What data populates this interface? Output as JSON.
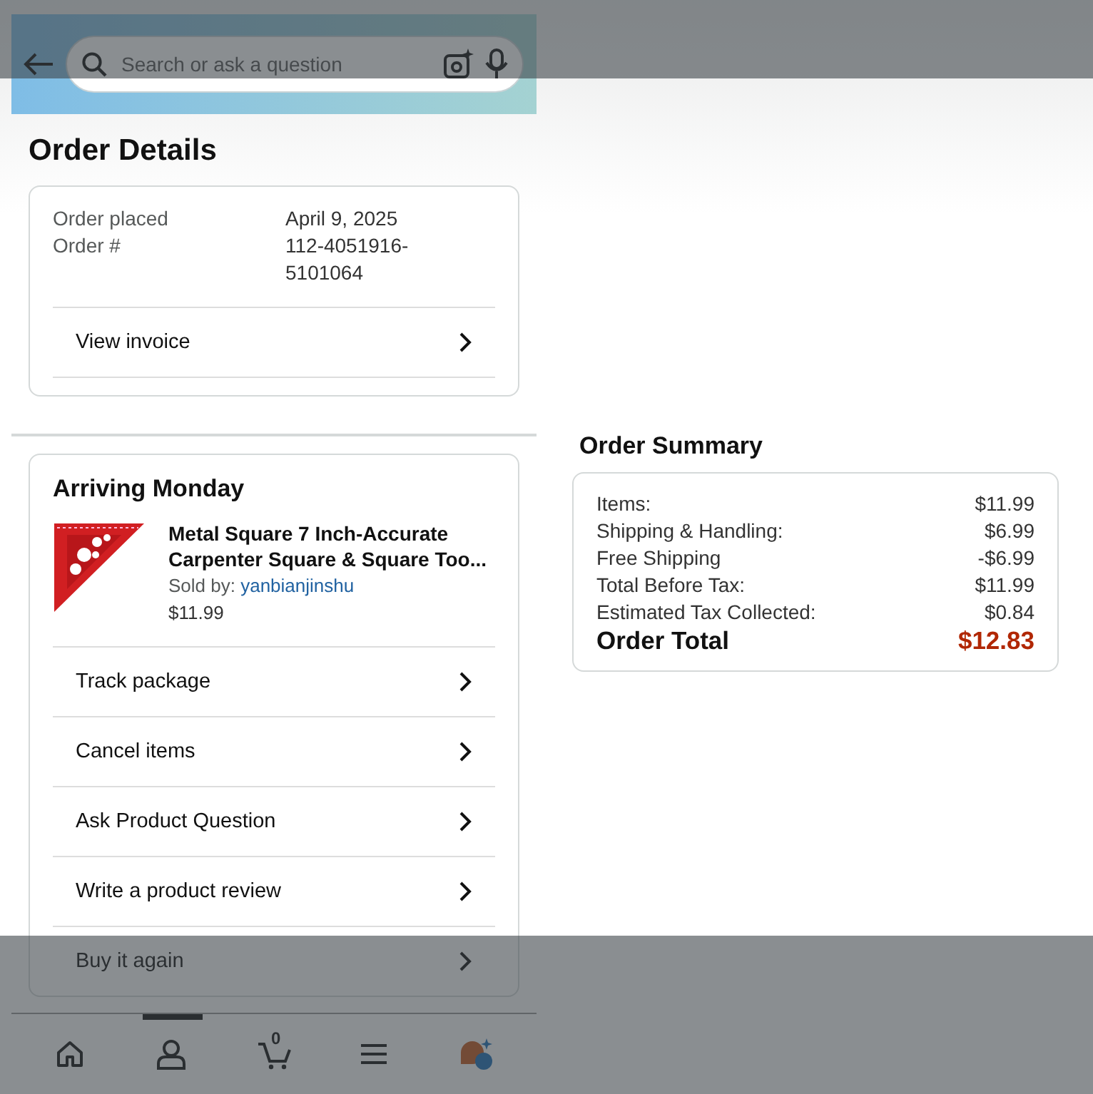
{
  "header": {
    "search": {
      "placeholder": "Search or ask a question"
    }
  },
  "page_title": "Order Details",
  "order_info": {
    "rows": [
      {
        "label": "Order placed",
        "value": "April 9, 2025"
      },
      {
        "label": "Order #",
        "value": "112-4051916-5101064"
      }
    ],
    "invoice_link": "View invoice"
  },
  "shipment": {
    "heading": "Arriving Monday",
    "product": {
      "title": "Metal Square 7 Inch-Accurate Carpenter Square & Square Too...",
      "sold_by_label": "Sold by:",
      "seller": "yanbianjinshu",
      "price": "$11.99"
    },
    "actions": [
      "Track package",
      "Cancel items",
      "Ask Product Question",
      "Write a product review",
      "Buy it again"
    ]
  },
  "summary": {
    "title": "Order Summary",
    "lines": [
      {
        "label": "Items:",
        "value": "$11.99"
      },
      {
        "label": "Shipping & Handling:",
        "value": "$6.99"
      },
      {
        "label": "Free Shipping",
        "value": "-$6.99"
      },
      {
        "label": "Total Before Tax:",
        "value": "$11.99"
      },
      {
        "label": "Estimated Tax Collected:",
        "value": "$0.84"
      }
    ],
    "total": {
      "label": "Order Total",
      "value": "$12.83"
    }
  },
  "nav": {
    "items": [
      {
        "kind": "home",
        "selected": false
      },
      {
        "kind": "account",
        "selected": true
      },
      {
        "kind": "cart",
        "selected": false,
        "badge": "0"
      },
      {
        "kind": "menu",
        "selected": false
      },
      {
        "kind": "assistant",
        "selected": false
      }
    ]
  }
}
